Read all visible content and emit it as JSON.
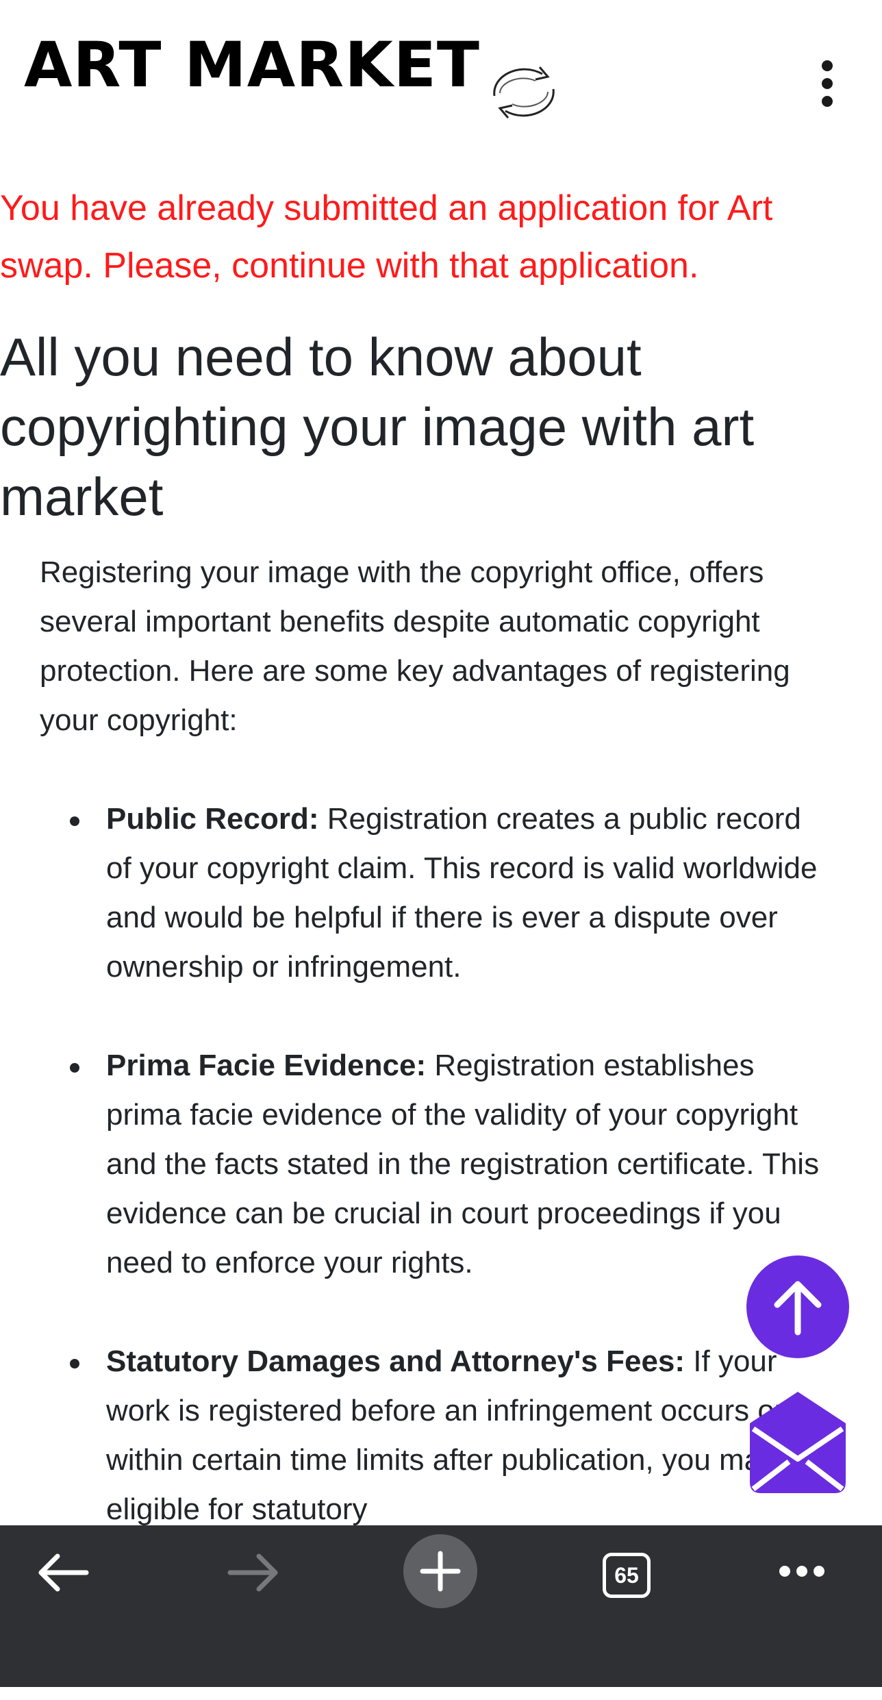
{
  "app": {
    "logo_text": "ART MARKET"
  },
  "alert": {
    "text": "You have already submitted an application for Art swap. Please, continue with that application."
  },
  "article": {
    "heading": "All you need to know about copyrighting your image with art market",
    "intro": "Registering your image with the copyright office, offers several important benefits despite automatic copyright protection. Here are some key advantages of registering your copyright:",
    "benefits": [
      {
        "title": "Public Record:",
        "text": " Registration creates a public record of your copyright claim. This record is valid worldwide and would be helpful if there is ever a dispute over ownership or infringement."
      },
      {
        "title": "Prima Facie Evidence:",
        "text": " Registration establishes prima facie evidence of the validity of your copyright and the facts stated in the registration certificate. This evidence can be crucial in court proceedings if you need to enforce your rights."
      },
      {
        "title": "Statutory Damages and Attorney's Fees:",
        "text": " If your work is registered before an infringement occurs or within certain time limits after publication, you may be eligible for statutory"
      }
    ]
  },
  "toolbar": {
    "tabs_count": "65"
  },
  "colors": {
    "alert": "#ff1a1a",
    "accent": "#6a2ce0",
    "toolbar_bg": "#2f3033"
  },
  "icons": [
    "swap-icon",
    "more-vertical-icon",
    "arrow-up-icon",
    "mail-icon",
    "back-arrow-icon",
    "forward-arrow-icon",
    "plus-icon",
    "tabs-icon",
    "more-horizontal-icon"
  ]
}
